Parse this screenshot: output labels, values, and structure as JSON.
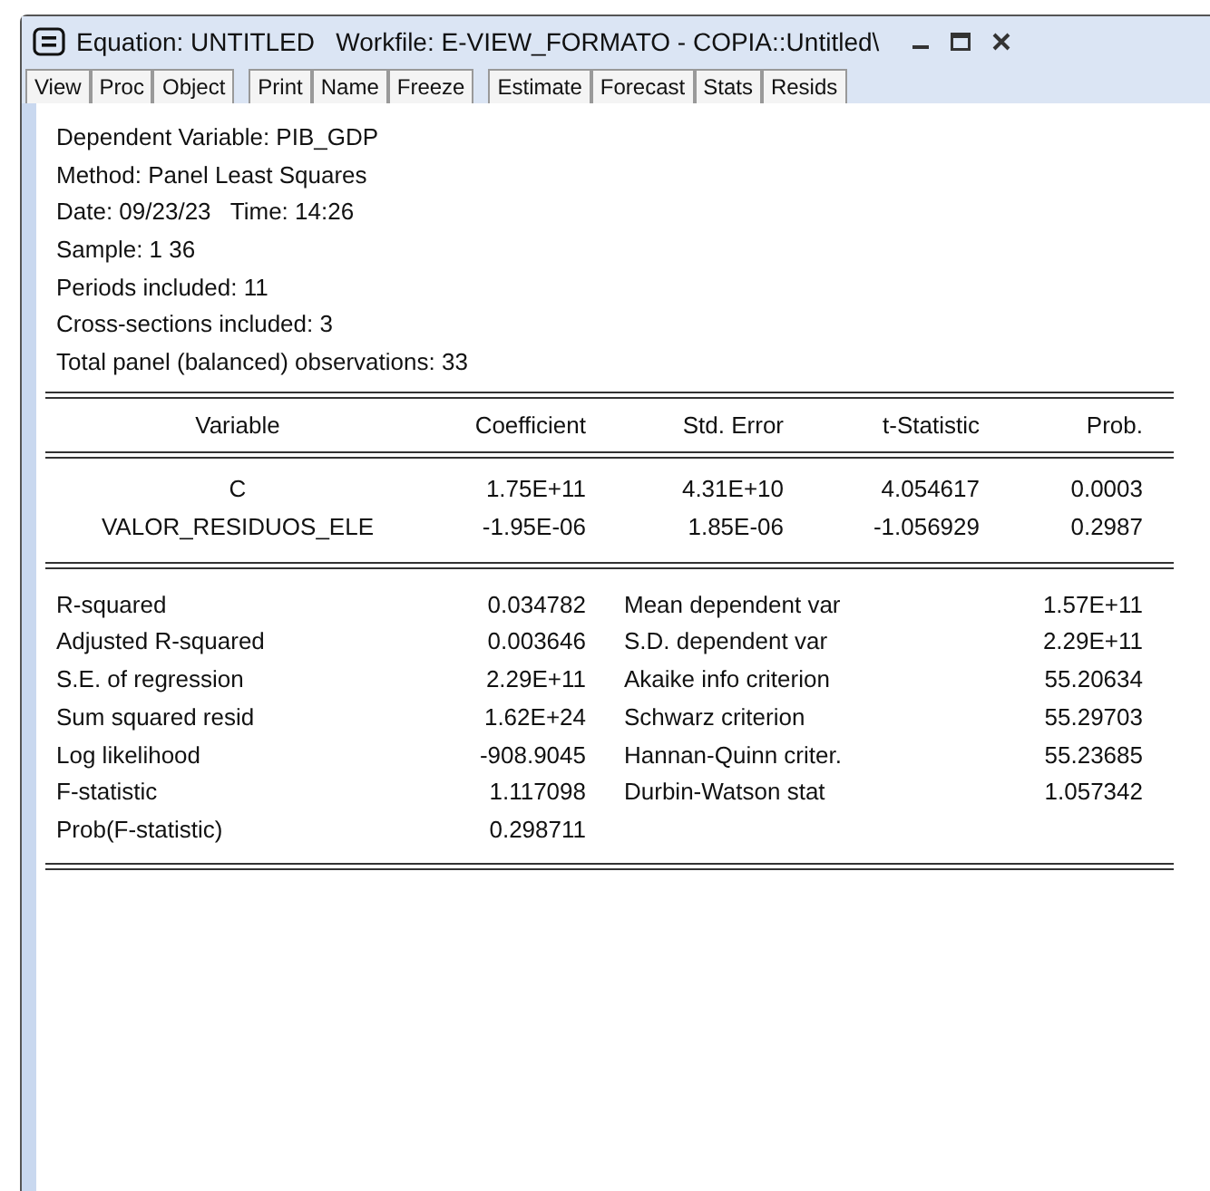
{
  "window": {
    "title": "Equation: UNTITLED   Workfile: E-VIEW_FORMATO - COPIA::Untitled\\"
  },
  "toolbar": [
    [
      "View",
      "Proc",
      "Object"
    ],
    [
      "Print",
      "Name",
      "Freeze"
    ],
    [
      "Estimate",
      "Forecast",
      "Stats",
      "Resids"
    ]
  ],
  "header_lines": [
    "Dependent Variable: PIB_GDP",
    "Method: Panel Least Squares",
    "Date: 09/23/23   Time: 14:26",
    "Sample: 1 36",
    "Periods included: 11",
    "Cross-sections included: 3",
    "Total panel (balanced) observations: 33"
  ],
  "table": {
    "columns": [
      "Variable",
      "Coefficient",
      "Std. Error",
      "t-Statistic",
      "Prob."
    ],
    "rows": [
      [
        "C",
        "1.75E+11",
        "4.31E+10",
        "4.054617",
        "0.0003"
      ],
      [
        "VALOR_RESIDUOS_ELE",
        "-1.95E-06",
        "1.85E-06",
        "-1.056929",
        "0.2987"
      ]
    ]
  },
  "statistics": [
    [
      "R-squared",
      "0.034782",
      "Mean dependent var",
      "1.57E+11"
    ],
    [
      "Adjusted R-squared",
      "0.003646",
      "S.D. dependent var",
      "2.29E+11"
    ],
    [
      "S.E. of regression",
      "2.29E+11",
      "Akaike info criterion",
      "55.20634"
    ],
    [
      "Sum squared resid",
      "1.62E+24",
      "Schwarz criterion",
      "55.29703"
    ],
    [
      "Log likelihood",
      "-908.9045",
      "Hannan-Quinn criter.",
      "55.23685"
    ],
    [
      "F-statistic",
      "1.117098",
      "Durbin-Watson stat",
      "1.057342"
    ],
    [
      "Prob(F-statistic)",
      "0.298711"
    ]
  ]
}
